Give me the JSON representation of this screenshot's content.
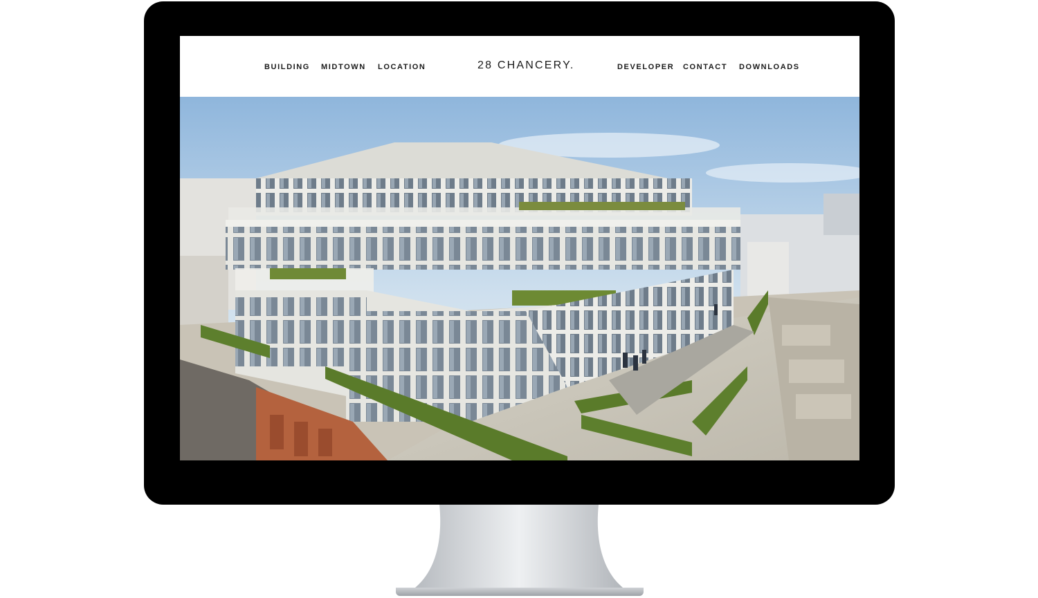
{
  "nav": {
    "left": [
      "BUILDING",
      "MIDTOWN",
      "LOCATION"
    ],
    "right": [
      "DEVELOPER",
      "CONTACT",
      "DOWNLOADS"
    ]
  },
  "logo": "28 CHANCERY.",
  "hero": {
    "image": "architectural-rendering-office-building-roof-terrace"
  },
  "colors": {
    "monitor_bezel": "#000000",
    "nav_text": "#1a1a1a",
    "sky": "#b8d2ea",
    "facade": "#e4e4df",
    "hedge": "#5d7f2d",
    "brick": "#b4623e"
  }
}
